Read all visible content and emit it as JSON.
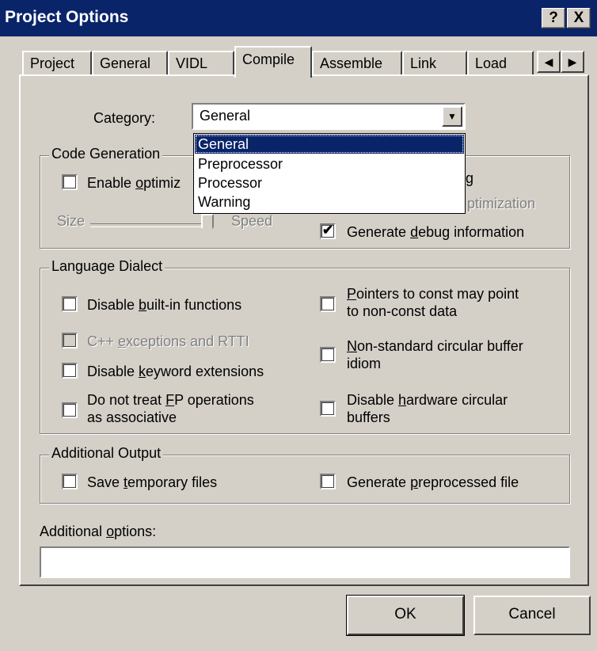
{
  "window": {
    "title": "Project Options",
    "help_button": "?",
    "close_button": "X"
  },
  "tabs": [
    {
      "label": "Project"
    },
    {
      "label": "General"
    },
    {
      "label": "VIDL"
    },
    {
      "label": "Compile",
      "active": true
    },
    {
      "label": "Assemble"
    },
    {
      "label": "Link"
    },
    {
      "label": "Load"
    }
  ],
  "category": {
    "label": "Category:",
    "value": "General",
    "options": [
      "General",
      "Preprocessor",
      "Processor",
      "Warning"
    ],
    "selected_index": 0
  },
  "code_generation": {
    "legend": "Code Generation",
    "enable_optimization": {
      "label_pre": "Enable ",
      "label_u": "o",
      "label_post": "ptimiz",
      "checked": false
    },
    "slider": {
      "left_label": "Size",
      "right_label": "Speed"
    },
    "hidden_right_top": "g",
    "hidden_right_mid": "ptimization",
    "generate_debug": {
      "label_pre": "Generate ",
      "label_u": "d",
      "label_post": "ebug information",
      "checked": true
    }
  },
  "language_dialect": {
    "legend": "Language Dialect",
    "disable_builtin": {
      "label_pre": "Disable ",
      "label_u": "b",
      "label_post": "uilt-in functions",
      "checked": false
    },
    "cpp_exceptions": {
      "label_pre": "C++ ",
      "label_u": "e",
      "label_post": "xceptions and RTTI",
      "checked": false,
      "disabled": true
    },
    "disable_keyword": {
      "label_pre": "Disable ",
      "label_u": "k",
      "label_post": "eyword extensions",
      "checked": false
    },
    "fp_ops": {
      "line1_pre": "Do not treat ",
      "line1_u": "F",
      "line1_post": "P operations",
      "line2": "as associative",
      "checked": false
    },
    "pointers_const": {
      "line1_u": "P",
      "line1_post": "ointers to const may point",
      "line2": "to non-const data",
      "checked": false
    },
    "circular_idiom": {
      "line1_u": "N",
      "line1_post": "on-standard circular buffer",
      "line2": "idiom",
      "checked": false
    },
    "disable_hw_circular": {
      "line1_pre": "Disable ",
      "line1_u": "h",
      "line1_post": "ardware circular",
      "line2": "buffers",
      "checked": false
    }
  },
  "additional_output": {
    "legend": "Additional Output",
    "save_temp": {
      "label_pre": "Save ",
      "label_u": "t",
      "label_post": "emporary files",
      "checked": false
    },
    "gen_preprocessed": {
      "label_pre": "Generate ",
      "label_u": "p",
      "label_post": "reprocessed file",
      "checked": false
    }
  },
  "additional_options": {
    "label_pre": "Additional ",
    "label_u": "o",
    "label_post": "ptions:",
    "value": ""
  },
  "buttons": {
    "ok": "OK",
    "cancel": "Cancel"
  },
  "icons": {
    "check": "✔",
    "dropdown_arrow": "▼",
    "tab_left": "◀",
    "tab_right": "▶"
  },
  "colors": {
    "title_bar": "#0a246a",
    "selection": "#0a246a",
    "face": "#d4d0c8"
  }
}
